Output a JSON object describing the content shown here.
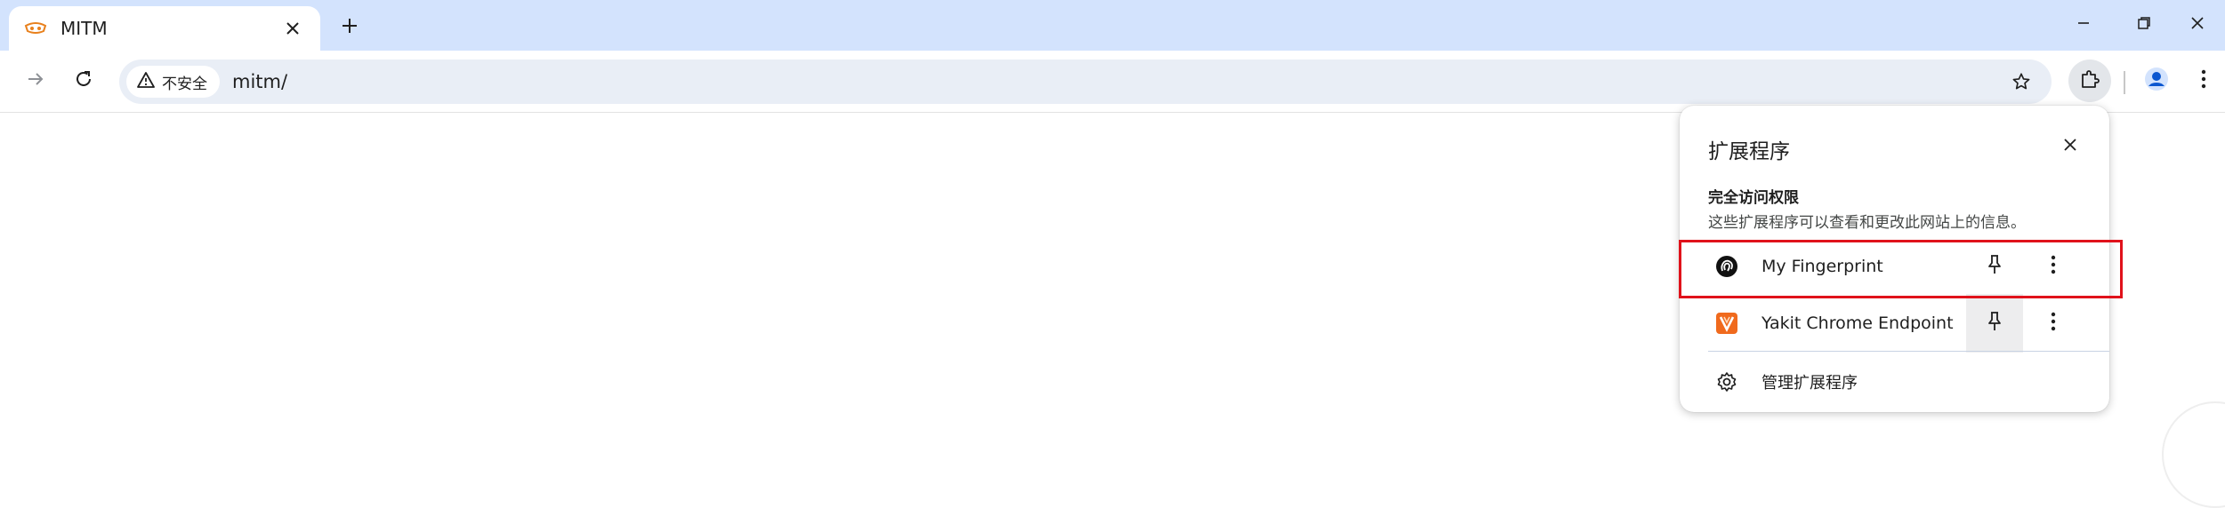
{
  "tab": {
    "title": "MITM",
    "favicon_icon": "mitm-hat-icon",
    "close_icon": "close-icon"
  },
  "tabstrip": {
    "new_tab_icon": "plus-icon",
    "window_controls": [
      "minimize-icon",
      "restore-icon",
      "close-icon"
    ]
  },
  "toolbar": {
    "security_label": "不安全",
    "security_icon": "warning-triangle-icon",
    "url": "mitm/",
    "accent": "#d3e3fd",
    "omnibox_bg": "#e9eef6"
  },
  "extensions_popup": {
    "title": "扩展程序",
    "section_title": "完全访问权限",
    "section_desc": "这些扩展程序可以查看和更改此网站上的信息。",
    "items": [
      {
        "name": "My Fingerprint",
        "icon": "fingerprint-icon",
        "highlighted": true
      },
      {
        "name": "Yakit Chrome Endpoint",
        "icon": "yakit-icon",
        "highlighted": false
      }
    ],
    "manage_label": "管理扩展程序",
    "highlight_color": "#e0121b"
  }
}
